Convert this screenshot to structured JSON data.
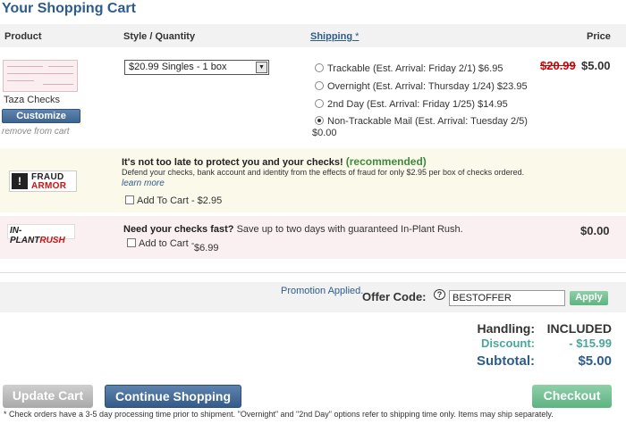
{
  "page_title": "Your Shopping Cart",
  "columns": {
    "product": "Product",
    "style_quantity": "Style / Quantity",
    "shipping": "Shipping",
    "shipping_star": "*",
    "price": "Price"
  },
  "item": {
    "name": "Taza Checks",
    "customize_label": "Customize",
    "remove_label": "remove from cart",
    "selected_option": "$20.99 Singles - 1 box",
    "old_price": "$20.99",
    "new_price": "$5.00",
    "shipping_options": [
      {
        "label": "Trackable (Est. Arrival: Friday 2/1) $6.95",
        "selected": false
      },
      {
        "label": "Overnight (Est. Arrival: Thursday 1/24) $23.95",
        "selected": false
      },
      {
        "label": "2nd Day (Est. Arrival: Friday 1/25) $14.95",
        "selected": false
      },
      {
        "label": "Non-Trackable Mail (Est. Arrival: Tuesday 2/5)",
        "selected": true
      }
    ],
    "shipping_total": "$0.00"
  },
  "fraud_armor": {
    "logo_line1": "FRAUD",
    "logo_line2": "ARMOR",
    "headline": "It's not too late to protect you and your checks!",
    "recommended": "(recommended)",
    "description": "Defend your checks, bank account and identity from the effects of fraud for only $2.95 per box of checks ordered.",
    "learn_more": "learn more",
    "add_label": "Add To Cart - $2.95"
  },
  "in_plant_rush": {
    "logo_part1": "IN-PLANT",
    "logo_part2": "RUSH",
    "headline_bold": "Need your checks fast?",
    "headline_rest": "Save up to two days with guaranteed In-Plant Rush.",
    "add_label": "Add to Cart -",
    "add_price": "$6.99",
    "total": "$0.00"
  },
  "promo": {
    "applied_text": "Promotion Applied.",
    "offer_label": "Offer Code:",
    "offer_value": "BESTOFFER",
    "apply_label": "Apply",
    "help_icon": "chat-help-icon"
  },
  "summary": {
    "handling_label": "Handling:",
    "handling_value": "INCLUDED",
    "discount_label": "Discount:",
    "discount_value": "- $15.99",
    "subtotal_label": "Subtotal:",
    "subtotal_value": "$5.00"
  },
  "actions": {
    "update_cart": "Update Cart",
    "continue_shopping": "Continue Shopping",
    "checkout": "Checkout"
  },
  "footnote": "* Check orders have a 3-5 day processing time prior to shipment. \"Overnight\" and \"2nd Day\" options refer to shipping time only. Items may ship separately.",
  "colors": {
    "brand_blue": "#2d5c8c",
    "accent_green": "#5db381",
    "discount_teal": "#4aa69a",
    "strike_red": "#cc0000"
  }
}
